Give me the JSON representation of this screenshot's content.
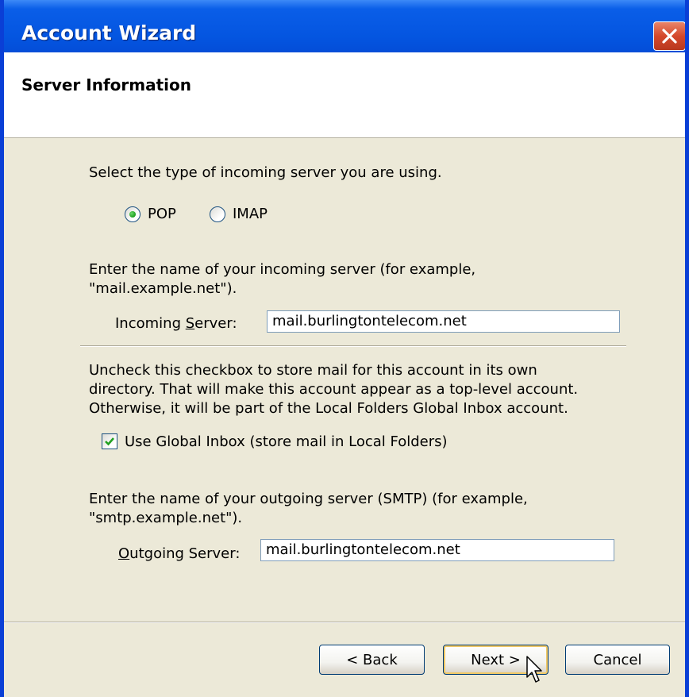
{
  "window": {
    "title": "Account Wizard",
    "close_icon": "close-icon"
  },
  "header": {
    "title": "Server Information"
  },
  "server_type": {
    "prompt": "Select the type of incoming server you are using.",
    "options": [
      {
        "label": "POP",
        "selected": true
      },
      {
        "label": "IMAP",
        "selected": false
      }
    ]
  },
  "incoming": {
    "prompt_line1": "Enter the name of your incoming server (for example,",
    "prompt_line2": "\"mail.example.net\").",
    "label_pre": "Incoming ",
    "label_accel": "S",
    "label_post": "erver:",
    "value": "mail.burlingtontelecom.net"
  },
  "global_inbox": {
    "desc_line1": "Uncheck this checkbox to store mail for this account in its own",
    "desc_line2": "directory. That will make this account appear as a top-level account.",
    "desc_line3": "Otherwise, it will be part of the Local Folders Global Inbox account.",
    "checkbox_label": "Use Global Inbox (store mail in Local Folders)",
    "checked": true
  },
  "outgoing": {
    "prompt_line1": "Enter the name of your outgoing server (SMTP) (for example,",
    "prompt_line2": "\"smtp.example.net\").",
    "label_accel": "O",
    "label_post": "utgoing Server:",
    "value": "mail.burlingtontelecom.net"
  },
  "buttons": {
    "back": "< Back",
    "next": "Next >",
    "cancel": "Cancel"
  },
  "colors": {
    "titlebar": "#0455e0",
    "dialog_bg": "#ece9d8",
    "radio_selected": "#1b9e1b",
    "checkmark": "#21a121"
  }
}
